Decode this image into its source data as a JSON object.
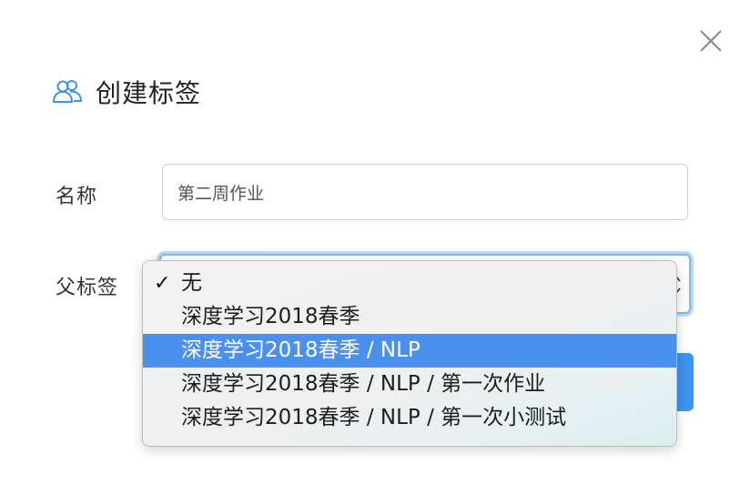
{
  "dialog": {
    "title": "创建标签",
    "title_icon": "users-icon",
    "close_icon": "close-icon"
  },
  "form": {
    "name_label": "名称",
    "name_value": "第二周作业",
    "parent_label": "父标签"
  },
  "dropdown": {
    "options": [
      {
        "label": "无",
        "checked": true,
        "highlighted": false
      },
      {
        "label": "深度学习2018春季",
        "checked": false,
        "highlighted": false
      },
      {
        "label": "深度学习2018春季 / NLP",
        "checked": false,
        "highlighted": true
      },
      {
        "label": "深度学习2018春季 / NLP / 第一次作业",
        "checked": false,
        "highlighted": false
      },
      {
        "label": "深度学习2018春季 / NLP / 第一次小测试",
        "checked": false,
        "highlighted": false
      }
    ],
    "checkmark": "✓"
  },
  "colors": {
    "accent": "#3e93f0",
    "icon": "#3b93e8",
    "highlight": "#4a90ee"
  }
}
